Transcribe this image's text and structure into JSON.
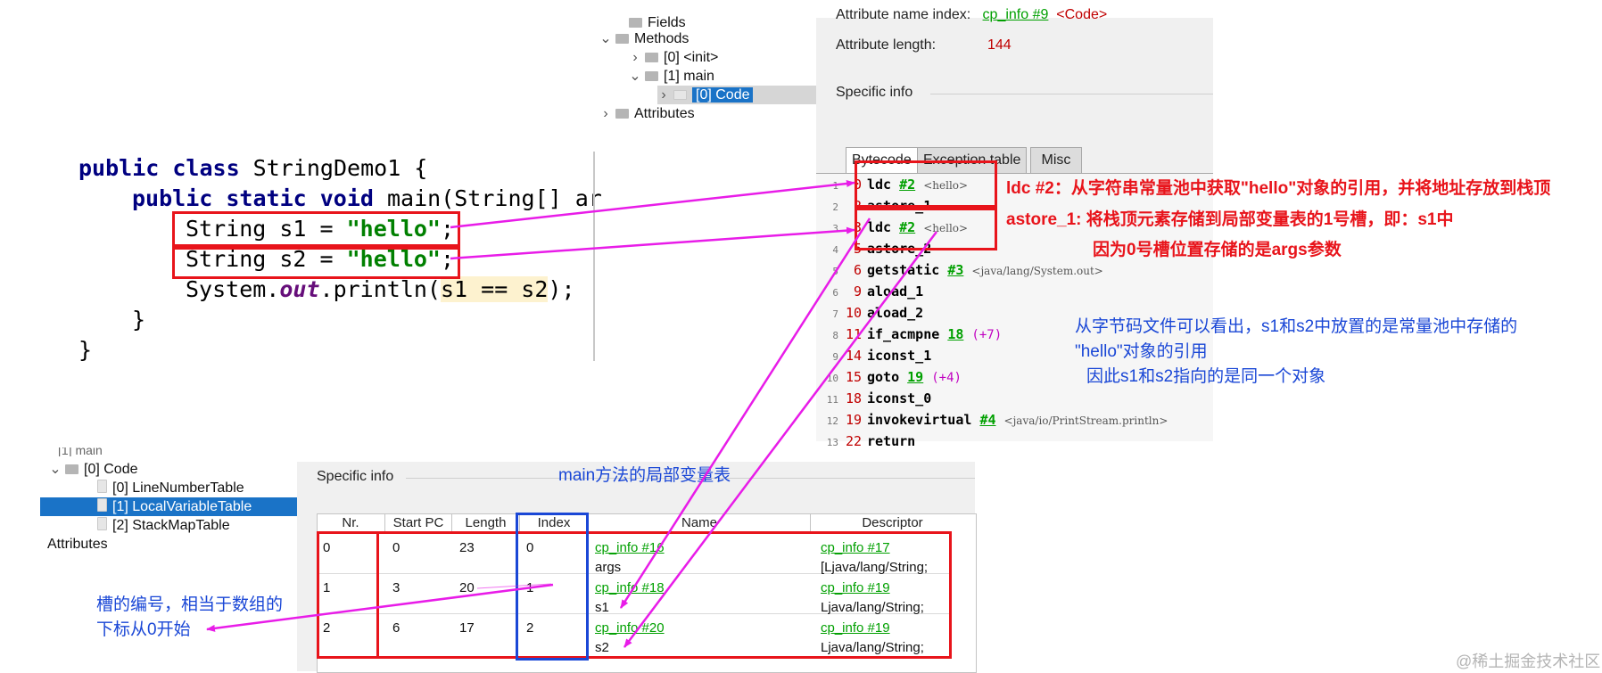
{
  "java_source": {
    "line1": {
      "kw": "public class",
      "rest": " StringDemo1 {"
    },
    "line2": {
      "kw": "public static void",
      "rest": " main(String[] ar"
    },
    "line3": {
      "pre": "String s1 = ",
      "str": "\"hello\"",
      "post": ";"
    },
    "line4": {
      "pre": "String s2 = ",
      "str": "\"hello\"",
      "post": ";"
    },
    "line5": {
      "pre": "System.",
      "fld": "out",
      "mid": ".println(",
      "hl": "s1 == s2",
      "post": ");"
    },
    "line6": "}",
    "line7": "}"
  },
  "tree_top": {
    "fields": "Fields",
    "methods": "Methods",
    "init": "[0] <init>",
    "main": "[1] main",
    "code": "[0] Code",
    "attributes": "Attributes"
  },
  "bytecode_panel": {
    "attr_name_label": "Attribute name index:",
    "attr_name_value": "cp_info #9",
    "attr_name_extra": "<Code>",
    "attr_length_label": "Attribute length:",
    "attr_length_value": "144",
    "specific_info": "Specific info",
    "tabs": [
      "Bytecode",
      "Exception table",
      "Misc"
    ],
    "rows": [
      {
        "n": "1",
        "pc": "0",
        "op": "ldc",
        "ref": "#2",
        "cmt": "<hello>"
      },
      {
        "n": "2",
        "pc": "2",
        "op": "astore_1"
      },
      {
        "n": "3",
        "pc": "3",
        "op": "ldc",
        "ref": "#2",
        "cmt": "<hello>"
      },
      {
        "n": "4",
        "pc": "5",
        "op": "astore_2"
      },
      {
        "n": "5",
        "pc": "6",
        "op": "getstatic",
        "ref": "#3",
        "cmt": "<java/lang/System.out>"
      },
      {
        "n": "6",
        "pc": "9",
        "op": "aload_1"
      },
      {
        "n": "7",
        "pc": "10",
        "op": "aload_2"
      },
      {
        "n": "8",
        "pc": "11",
        "op": "if_acmpne",
        "ref": "18",
        "off": "(+7)"
      },
      {
        "n": "9",
        "pc": "14",
        "op": "iconst_1"
      },
      {
        "n": "10",
        "pc": "15",
        "op": "goto",
        "ref": "19",
        "off": "(+4)"
      },
      {
        "n": "11",
        "pc": "18",
        "op": "iconst_0"
      },
      {
        "n": "12",
        "pc": "19",
        "op": "invokevirtual",
        "ref": "#4",
        "cmt": "<java/io/PrintStream.println>"
      },
      {
        "n": "13",
        "pc": "22",
        "op": "return"
      }
    ]
  },
  "tree_bottom": {
    "main_partial": "[1] main",
    "code": "[0] Code",
    "line_number_table": "[0] LineNumberTable",
    "local_variable_table": "[1] LocalVariableTable",
    "stack_map_table": "[2] StackMapTable",
    "attributes": "Attributes"
  },
  "lvt_panel": {
    "specific_info": "Specific info",
    "headers": [
      "Nr.",
      "Start PC",
      "Length",
      "Index",
      "Name",
      "Descriptor"
    ],
    "rows": [
      {
        "nr": "0",
        "start": "0",
        "length": "23",
        "index": "0",
        "name_ref": "cp_info #16",
        "name": "args",
        "desc_ref": "cp_info #17",
        "desc": "[Ljava/lang/String;"
      },
      {
        "nr": "1",
        "start": "3",
        "length": "20",
        "index": "1",
        "name_ref": "cp_info #18",
        "name": "s1",
        "desc_ref": "cp_info #19",
        "desc": "Ljava/lang/String;"
      },
      {
        "nr": "2",
        "start": "6",
        "length": "17",
        "index": "2",
        "name_ref": "cp_info #20",
        "name": "s2",
        "desc_ref": "cp_info #19",
        "desc": "Ljava/lang/String;"
      }
    ]
  },
  "annotations": {
    "ldc": "ldc #2：从字符串常量池中获取\"hello\"对象的引用，并将地址存放到栈顶",
    "astore": "astore_1: 将栈顶元素存储到局部变量表的1号槽，即：s1中",
    "astore_reason": "因为0号槽位置存储的是args参数",
    "bytecode_note1": "从字节码文件可以看出，s1和s2中放置的是常量池中存储的",
    "bytecode_note2": "\"hello\"对象的引用",
    "bytecode_note3": "因此s1和s2指向的是同一个对象",
    "lvt_title": "main方法的局部变量表",
    "slot_note1": "槽的编号，相当于数组的",
    "slot_note2": "下标从0开始"
  },
  "watermark": "@稀土掘金技术社区",
  "colors": {
    "annotation_red": "#e8141b",
    "annotation_blue": "#1a47d6",
    "arrow_magenta": "#e81ce8",
    "link_green": "#00a000",
    "selection_blue": "#1a73c7"
  }
}
